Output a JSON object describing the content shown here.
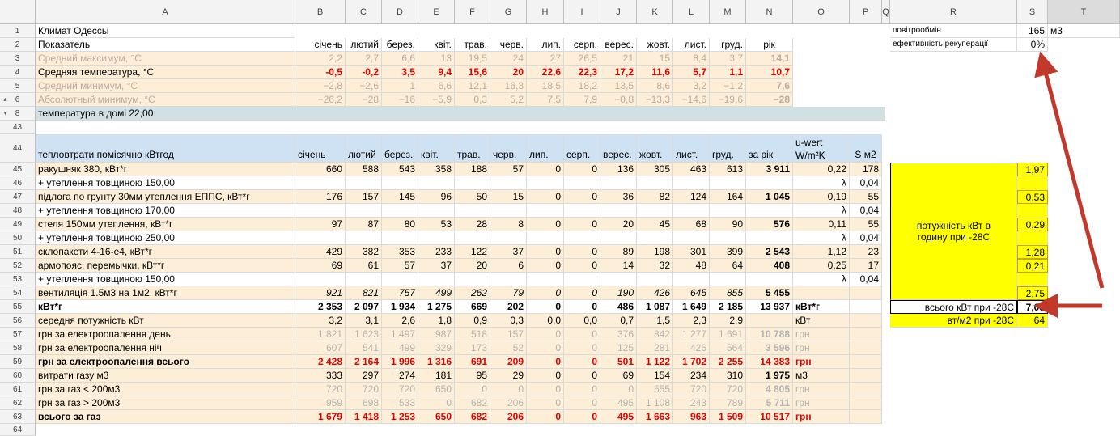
{
  "columns": [
    "A",
    "B",
    "C",
    "D",
    "E",
    "F",
    "G",
    "H",
    "I",
    "J",
    "K",
    "L",
    "M",
    "N",
    "O",
    "P",
    "Q",
    "R",
    "S",
    "T"
  ],
  "top": {
    "row1": {
      "a": "Климат Одессы"
    },
    "row2": {
      "a": "Показатель",
      "months": [
        "січень",
        "лютий",
        "берез.",
        "квіт.",
        "трав.",
        "черв.",
        "лип.",
        "серп.",
        "верес.",
        "жовт.",
        "лист.",
        "груд."
      ],
      "year": "рік"
    },
    "row3": {
      "a": "Средний максимум, °C",
      "vals": [
        "2,2",
        "2,7",
        "6,6",
        "13",
        "19,5",
        "24",
        "27",
        "26,5",
        "21",
        "15",
        "8,4",
        "3,7"
      ],
      "year": "14,1"
    },
    "row4": {
      "a": "Средняя температура, °C",
      "vals": [
        "-0,5",
        "-0,2",
        "3,5",
        "9,4",
        "15,6",
        "20",
        "22,6",
        "22,3",
        "17,2",
        "11,6",
        "5,7",
        "1,1"
      ],
      "year": "10,7"
    },
    "row5": {
      "a": "Средний минимум, °C",
      "vals": [
        "−2,8",
        "−2,6",
        "1",
        "6,6",
        "12,1",
        "16,3",
        "18,5",
        "18,2",
        "13,5",
        "8,6",
        "3,2",
        "−1,2"
      ],
      "year": "7,6"
    },
    "row6": {
      "a": "Абсолютный минимум, °C",
      "vals": [
        "−26,2",
        "−28",
        "−16",
        "−5,9",
        "0,3",
        "5,2",
        "7,5",
        "7,9",
        "−0,8",
        "−13,3",
        "−14,6",
        "−19,6"
      ],
      "year": "−28"
    },
    "row8": {
      "a": "температура в домі 22,00"
    }
  },
  "side": {
    "r1_label": "повітрообмін",
    "r1_val": "165",
    "r1_unit": "м3",
    "r2_label": "ефективність рекуперації",
    "r2_val": "0%",
    "power_label": "потужність кВт в годину при -28С",
    "power_vals": [
      "1,97",
      "0,53",
      "0,29",
      "1,28",
      "0,21",
      "2,75"
    ],
    "total_label": "всього кВт при -28С",
    "total_val": "7,03",
    "per_m2_label": "вт/м2 при -28С",
    "per_m2_val": "64"
  },
  "table": {
    "head": {
      "a": "тепловтрати помісячно кВтгод",
      "months": [
        "січень",
        "лютий",
        "берез.",
        "квіт.",
        "трав.",
        "черв.",
        "лип.",
        "серп.",
        "верес.",
        "жовт.",
        "лист.",
        "груд."
      ],
      "n": "за рік",
      "o1": "u-wert",
      "o2": "W/m²K",
      "p": "S м2"
    },
    "rows": [
      {
        "num": "45",
        "a": "ракушняк 380, кВт*г",
        "v": [
          "660",
          "588",
          "543",
          "358",
          "188",
          "57",
          "0",
          "0",
          "136",
          "305",
          "463",
          "613"
        ],
        "n": "3 911",
        "o": "0,22",
        "p": "178"
      },
      {
        "num": "46",
        "a": "+ утеплення товщиною 150,00",
        "v": [],
        "n": "",
        "o": "λ",
        "p": "0,04"
      },
      {
        "num": "47",
        "a": "підлога по грунту 30мм утеплення ЕППС, кВт*г",
        "v": [
          "176",
          "157",
          "145",
          "96",
          "50",
          "15",
          "0",
          "0",
          "36",
          "82",
          "124",
          "164"
        ],
        "n": "1 045",
        "o": "0,19",
        "p": "55"
      },
      {
        "num": "48",
        "a": "+ утеплення товщиною 170,00",
        "v": [],
        "n": "",
        "o": "λ",
        "p": "0,04"
      },
      {
        "num": "49",
        "a": "стеля 150мм утеплення, кВт*г",
        "v": [
          "97",
          "87",
          "80",
          "53",
          "28",
          "8",
          "0",
          "0",
          "20",
          "45",
          "68",
          "90"
        ],
        "n": "576",
        "o": "0,11",
        "p": "55"
      },
      {
        "num": "50",
        "a": "+ утеплення товщиною 250,00",
        "v": [],
        "n": "",
        "o": "λ",
        "p": "0,04"
      },
      {
        "num": "51",
        "a": "склопакети 4-16-е4, кВт*г",
        "v": [
          "429",
          "382",
          "353",
          "233",
          "122",
          "37",
          "0",
          "0",
          "89",
          "198",
          "301",
          "399"
        ],
        "n": "2 543",
        "o": "1,12",
        "p": "23"
      },
      {
        "num": "52",
        "a": "армопояс, перемычки, кВт*г",
        "v": [
          "69",
          "61",
          "57",
          "37",
          "20",
          "6",
          "0",
          "0",
          "14",
          "32",
          "48",
          "64"
        ],
        "n": "408",
        "o": "0,25",
        "p": "17"
      },
      {
        "num": "53",
        "a": "+ утеплення товщиною 150,00",
        "v": [],
        "n": "",
        "o": "λ",
        "p": "0,04"
      },
      {
        "num": "54",
        "a": "вентиляція 1.5м3 на 1м2, кВт*г",
        "v": [
          "921",
          "821",
          "757",
          "499",
          "262",
          "79",
          "0",
          "0",
          "190",
          "426",
          "645",
          "855"
        ],
        "n": "5 455",
        "o": "",
        "p": ""
      },
      {
        "num": "55",
        "a": "кВт*г",
        "v": [
          "2 353",
          "2 097",
          "1 934",
          "1 275",
          "669",
          "202",
          "0",
          "0",
          "486",
          "1 087",
          "1 649",
          "2 185"
        ],
        "n": "13 937",
        "o": "кВт*г",
        "p": ""
      },
      {
        "num": "56",
        "a": "середня потужність кВт",
        "v": [
          "3,2",
          "3,1",
          "2,6",
          "1,8",
          "0,9",
          "0,3",
          "0,0",
          "0,0",
          "0,7",
          "1,5",
          "2,3",
          "2,9"
        ],
        "n": "",
        "o": "кВт",
        "p": ""
      },
      {
        "num": "57",
        "a": "грн за електроопалення день",
        "v": [
          "1 821",
          "1 623",
          "1 497",
          "987",
          "518",
          "157",
          "0",
          "0",
          "376",
          "842",
          "1 277",
          "1 691"
        ],
        "n": "10 788",
        "o": "грн",
        "p": ""
      },
      {
        "num": "58",
        "a": "грн за електроопалення ніч",
        "v": [
          "607",
          "541",
          "499",
          "329",
          "173",
          "52",
          "0",
          "0",
          "125",
          "281",
          "426",
          "564"
        ],
        "n": "3 596",
        "o": "грн",
        "p": ""
      },
      {
        "num": "59",
        "a": "грн за електроопалення всього",
        "v": [
          "2 428",
          "2 164",
          "1 996",
          "1 316",
          "691",
          "209",
          "0",
          "0",
          "501",
          "1 122",
          "1 702",
          "2 255"
        ],
        "n": "14 383",
        "o": "грн",
        "p": ""
      },
      {
        "num": "60",
        "a": "витрати газу м3",
        "v": [
          "333",
          "297",
          "274",
          "181",
          "95",
          "29",
          "0",
          "0",
          "69",
          "154",
          "234",
          "310"
        ],
        "n": "1 975",
        "o": "м3",
        "p": ""
      },
      {
        "num": "61",
        "a": "грн за газ < 200м3",
        "v": [
          "720",
          "720",
          "720",
          "650",
          "0",
          "0",
          "0",
          "0",
          "0",
          "555",
          "720",
          "720"
        ],
        "n": "4 805",
        "o": "грн",
        "p": ""
      },
      {
        "num": "62",
        "a": "грн за газ > 200м3",
        "v": [
          "959",
          "698",
          "533",
          "0",
          "682",
          "206",
          "0",
          "0",
          "495",
          "1 108",
          "243",
          "789"
        ],
        "n": "5 711",
        "o": "грн",
        "p": ""
      },
      {
        "num": "63",
        "a": "всього за газ",
        "v": [
          "1 679",
          "1 418",
          "1 253",
          "650",
          "682",
          "206",
          "0",
          "0",
          "495",
          "1 663",
          "963",
          "1 509"
        ],
        "n": "10 517",
        "o": "грн",
        "p": ""
      }
    ]
  },
  "row_numbers_top": [
    "1",
    "2",
    "3",
    "4",
    "5",
    "6",
    "8",
    "43"
  ],
  "row64": "64",
  "colors": {
    "arrow": "#c0392b",
    "yellow": "#ffff00",
    "peach": "#fdefd7",
    "blue": "#cfe2f3"
  }
}
